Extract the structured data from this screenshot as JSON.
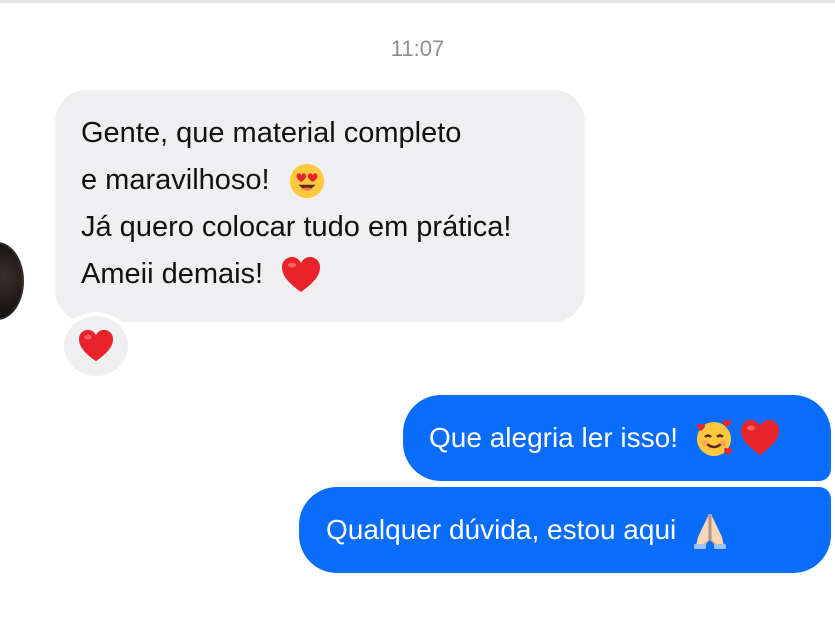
{
  "conversation": {
    "timestamp": "11:07",
    "incoming_message": {
      "lines": [
        "Gente, que material completo",
        "e maravilhoso!",
        "Já quero colocar tudo em prática!",
        "Ameii demais!"
      ],
      "emojis": [
        "heart-eyes-emoji",
        "red-heart-emoji"
      ],
      "reaction": "red-heart-emoji"
    },
    "outgoing_messages": [
      {
        "text": "Que alegria ler isso!",
        "emojis": [
          "smiling-face-with-hearts-emoji",
          "red-heart-emoji"
        ]
      },
      {
        "text": "Qualquer dúvida, estou aqui",
        "emojis": [
          "folded-hands-emoji"
        ]
      }
    ]
  },
  "colors": {
    "outgoing_bubble": "#0a6cfb",
    "incoming_bubble": "#efeff1",
    "timestamp_text": "#8e8e93",
    "heart": "#e8232b"
  }
}
